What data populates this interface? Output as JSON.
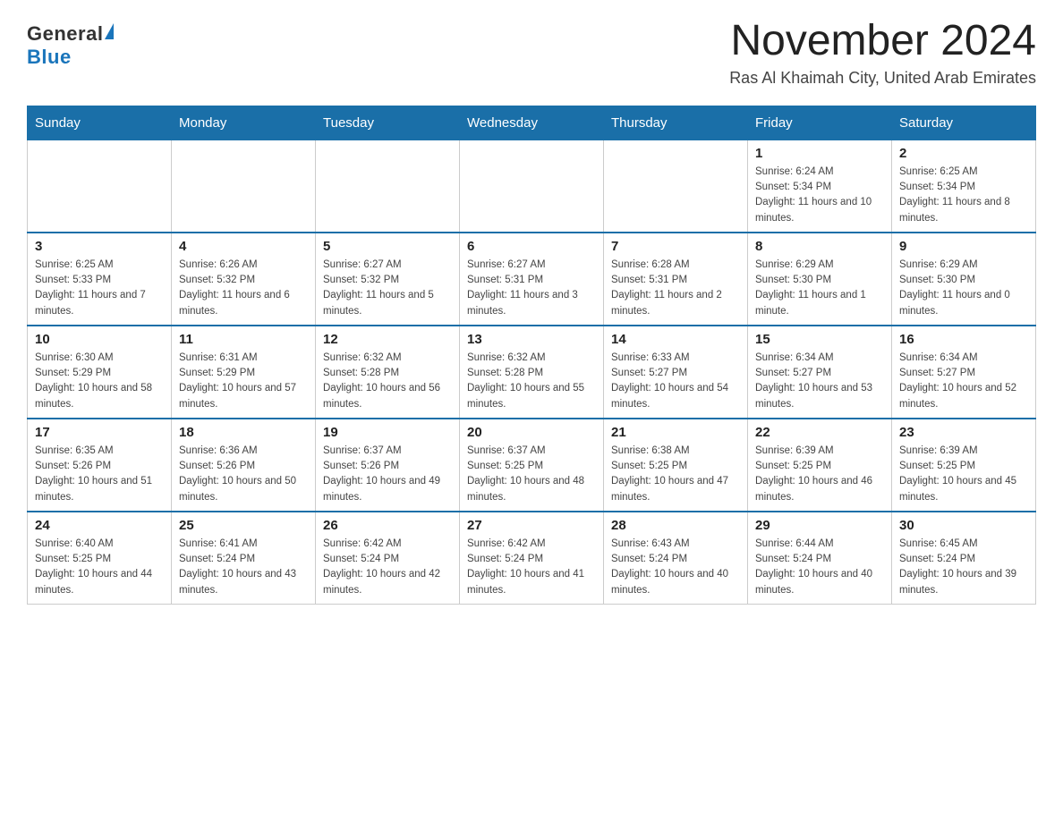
{
  "header": {
    "logo": {
      "general": "General",
      "blue": "Blue"
    },
    "title": "November 2024",
    "location": "Ras Al Khaimah City, United Arab Emirates"
  },
  "weekdays": [
    "Sunday",
    "Monday",
    "Tuesday",
    "Wednesday",
    "Thursday",
    "Friday",
    "Saturday"
  ],
  "weeks": [
    [
      {
        "day": "",
        "sunrise": "",
        "sunset": "",
        "daylight": ""
      },
      {
        "day": "",
        "sunrise": "",
        "sunset": "",
        "daylight": ""
      },
      {
        "day": "",
        "sunrise": "",
        "sunset": "",
        "daylight": ""
      },
      {
        "day": "",
        "sunrise": "",
        "sunset": "",
        "daylight": ""
      },
      {
        "day": "",
        "sunrise": "",
        "sunset": "",
        "daylight": ""
      },
      {
        "day": "1",
        "sunrise": "Sunrise: 6:24 AM",
        "sunset": "Sunset: 5:34 PM",
        "daylight": "Daylight: 11 hours and 10 minutes."
      },
      {
        "day": "2",
        "sunrise": "Sunrise: 6:25 AM",
        "sunset": "Sunset: 5:34 PM",
        "daylight": "Daylight: 11 hours and 8 minutes."
      }
    ],
    [
      {
        "day": "3",
        "sunrise": "Sunrise: 6:25 AM",
        "sunset": "Sunset: 5:33 PM",
        "daylight": "Daylight: 11 hours and 7 minutes."
      },
      {
        "day": "4",
        "sunrise": "Sunrise: 6:26 AM",
        "sunset": "Sunset: 5:32 PM",
        "daylight": "Daylight: 11 hours and 6 minutes."
      },
      {
        "day": "5",
        "sunrise": "Sunrise: 6:27 AM",
        "sunset": "Sunset: 5:32 PM",
        "daylight": "Daylight: 11 hours and 5 minutes."
      },
      {
        "day": "6",
        "sunrise": "Sunrise: 6:27 AM",
        "sunset": "Sunset: 5:31 PM",
        "daylight": "Daylight: 11 hours and 3 minutes."
      },
      {
        "day": "7",
        "sunrise": "Sunrise: 6:28 AM",
        "sunset": "Sunset: 5:31 PM",
        "daylight": "Daylight: 11 hours and 2 minutes."
      },
      {
        "day": "8",
        "sunrise": "Sunrise: 6:29 AM",
        "sunset": "Sunset: 5:30 PM",
        "daylight": "Daylight: 11 hours and 1 minute."
      },
      {
        "day": "9",
        "sunrise": "Sunrise: 6:29 AM",
        "sunset": "Sunset: 5:30 PM",
        "daylight": "Daylight: 11 hours and 0 minutes."
      }
    ],
    [
      {
        "day": "10",
        "sunrise": "Sunrise: 6:30 AM",
        "sunset": "Sunset: 5:29 PM",
        "daylight": "Daylight: 10 hours and 58 minutes."
      },
      {
        "day": "11",
        "sunrise": "Sunrise: 6:31 AM",
        "sunset": "Sunset: 5:29 PM",
        "daylight": "Daylight: 10 hours and 57 minutes."
      },
      {
        "day": "12",
        "sunrise": "Sunrise: 6:32 AM",
        "sunset": "Sunset: 5:28 PM",
        "daylight": "Daylight: 10 hours and 56 minutes."
      },
      {
        "day": "13",
        "sunrise": "Sunrise: 6:32 AM",
        "sunset": "Sunset: 5:28 PM",
        "daylight": "Daylight: 10 hours and 55 minutes."
      },
      {
        "day": "14",
        "sunrise": "Sunrise: 6:33 AM",
        "sunset": "Sunset: 5:27 PM",
        "daylight": "Daylight: 10 hours and 54 minutes."
      },
      {
        "day": "15",
        "sunrise": "Sunrise: 6:34 AM",
        "sunset": "Sunset: 5:27 PM",
        "daylight": "Daylight: 10 hours and 53 minutes."
      },
      {
        "day": "16",
        "sunrise": "Sunrise: 6:34 AM",
        "sunset": "Sunset: 5:27 PM",
        "daylight": "Daylight: 10 hours and 52 minutes."
      }
    ],
    [
      {
        "day": "17",
        "sunrise": "Sunrise: 6:35 AM",
        "sunset": "Sunset: 5:26 PM",
        "daylight": "Daylight: 10 hours and 51 minutes."
      },
      {
        "day": "18",
        "sunrise": "Sunrise: 6:36 AM",
        "sunset": "Sunset: 5:26 PM",
        "daylight": "Daylight: 10 hours and 50 minutes."
      },
      {
        "day": "19",
        "sunrise": "Sunrise: 6:37 AM",
        "sunset": "Sunset: 5:26 PM",
        "daylight": "Daylight: 10 hours and 49 minutes."
      },
      {
        "day": "20",
        "sunrise": "Sunrise: 6:37 AM",
        "sunset": "Sunset: 5:25 PM",
        "daylight": "Daylight: 10 hours and 48 minutes."
      },
      {
        "day": "21",
        "sunrise": "Sunrise: 6:38 AM",
        "sunset": "Sunset: 5:25 PM",
        "daylight": "Daylight: 10 hours and 47 minutes."
      },
      {
        "day": "22",
        "sunrise": "Sunrise: 6:39 AM",
        "sunset": "Sunset: 5:25 PM",
        "daylight": "Daylight: 10 hours and 46 minutes."
      },
      {
        "day": "23",
        "sunrise": "Sunrise: 6:39 AM",
        "sunset": "Sunset: 5:25 PM",
        "daylight": "Daylight: 10 hours and 45 minutes."
      }
    ],
    [
      {
        "day": "24",
        "sunrise": "Sunrise: 6:40 AM",
        "sunset": "Sunset: 5:25 PM",
        "daylight": "Daylight: 10 hours and 44 minutes."
      },
      {
        "day": "25",
        "sunrise": "Sunrise: 6:41 AM",
        "sunset": "Sunset: 5:24 PM",
        "daylight": "Daylight: 10 hours and 43 minutes."
      },
      {
        "day": "26",
        "sunrise": "Sunrise: 6:42 AM",
        "sunset": "Sunset: 5:24 PM",
        "daylight": "Daylight: 10 hours and 42 minutes."
      },
      {
        "day": "27",
        "sunrise": "Sunrise: 6:42 AM",
        "sunset": "Sunset: 5:24 PM",
        "daylight": "Daylight: 10 hours and 41 minutes."
      },
      {
        "day": "28",
        "sunrise": "Sunrise: 6:43 AM",
        "sunset": "Sunset: 5:24 PM",
        "daylight": "Daylight: 10 hours and 40 minutes."
      },
      {
        "day": "29",
        "sunrise": "Sunrise: 6:44 AM",
        "sunset": "Sunset: 5:24 PM",
        "daylight": "Daylight: 10 hours and 40 minutes."
      },
      {
        "day": "30",
        "sunrise": "Sunrise: 6:45 AM",
        "sunset": "Sunset: 5:24 PM",
        "daylight": "Daylight: 10 hours and 39 minutes."
      }
    ]
  ]
}
